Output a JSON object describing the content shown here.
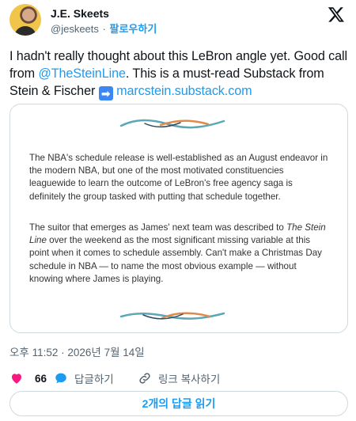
{
  "author": {
    "display_name": "J.E. Skeets",
    "handle": "@jeskeets",
    "separator": "·",
    "follow_label": "팔로우하기"
  },
  "tweet": {
    "text_part1": "I hadn't really thought about this LeBron angle yet. Good call from ",
    "mention": "@TheSteinLine",
    "text_part2": ". This is a must-read Substack from Stein & Fischer ",
    "arrow_emoji": "➡",
    "link": "marcstein.substack.com"
  },
  "card": {
    "paragraph1": "The NBA's schedule release is well-established as an August endeavor in the modern NBA, but one of the most motivated constituencies leaguewide to learn the outcome of LeBron's free agency saga is definitely the group tasked with putting that schedule together.",
    "paragraph2_before": "The suitor that emerges as James' next team was described to ",
    "paragraph2_italic": "The Stein Line",
    "paragraph2_after": " over the weekend as the most significant missing variable at this point when it comes to schedule assembly. Can't make a Christmas Day schedule in NBA — to name the most obvious example — without knowing where James is playing."
  },
  "timestamp": "오후 11:52 · 2026년 7월 14일",
  "actions": {
    "like_count": "66",
    "reply_label": "답글하기",
    "copy_link_label": "링크 복사하기"
  },
  "read_replies_label": "2개의 답글 읽기",
  "colors": {
    "accent": "#1d9bf0",
    "text": "#0f1419",
    "muted": "#536471",
    "like": "#f91880",
    "border": "#cfd9de"
  },
  "icons": [
    "x-logo-icon",
    "heart-icon",
    "reply-bubble-icon",
    "link-icon",
    "right-arrow-emoji-icon"
  ]
}
